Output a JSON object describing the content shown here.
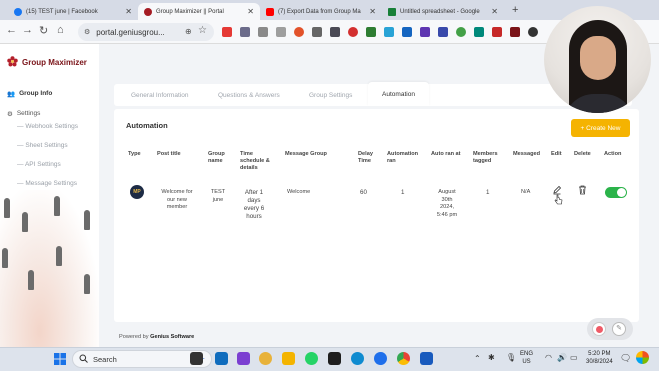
{
  "browser": {
    "tabs": [
      {
        "label": "(15) TEST june | Facebook",
        "color": "#1877f2"
      },
      {
        "label": "Group Maximizer || Portal",
        "color": "#a51c24"
      },
      {
        "label": "(7) Export Data from Group Ma",
        "color": "#ff0000"
      },
      {
        "label": "Untitled spreadsheet - Google",
        "color": "#188038"
      }
    ],
    "new_tab": "+",
    "url": "portal.geniusgrou..."
  },
  "app": {
    "name": "Group Maximizer",
    "sidebar": {
      "group_info": "Group Info",
      "settings": "Settings",
      "sub": [
        "Webhook Settings",
        "Sheet Settings",
        "API Settings",
        "Message Settings"
      ]
    },
    "tabs": [
      "General Information",
      "Questions & Answers",
      "Group Settings",
      "Automation"
    ],
    "section_title": "Automation",
    "create_button": "+ Create New",
    "table": {
      "headers": [
        "Type",
        "Post title",
        "Group name",
        "Time schedule & details",
        "Message Group",
        "Delay Time",
        "Automation ran",
        "Auto ran at",
        "Members tagged",
        "Messaged",
        "Edit",
        "Delete",
        "Action"
      ],
      "row": {
        "type_badge": "MP",
        "post_title": "Welcome for our new member",
        "group_name": "TEST june",
        "schedule": "After 1 days every 6 hours",
        "message_group": "Welcome",
        "delay": "60",
        "ran": "1",
        "ran_at": "August 30th 2024, 5:46 pm",
        "members": "1",
        "messaged": "N/A",
        "action_enabled": true
      }
    },
    "footer": {
      "prefix": "Powered by",
      "brand": "Genius Software"
    }
  },
  "taskbar": {
    "search_placeholder": "Search",
    "lang": "ENG",
    "region": "US",
    "time": "5:20 PM",
    "date": "30/8/2024"
  }
}
